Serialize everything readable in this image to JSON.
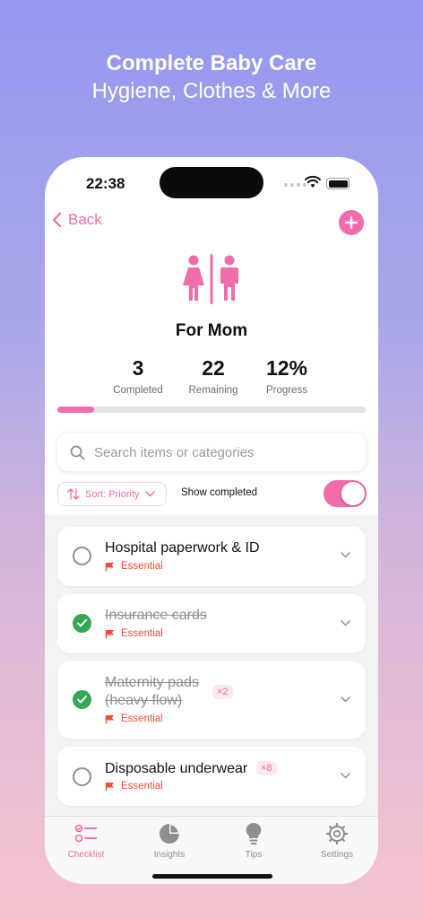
{
  "promo": {
    "headline": "Complete Baby Care",
    "subline": "Hygiene, Clothes & More"
  },
  "status_bar": {
    "time": "22:38"
  },
  "nav": {
    "back_label": "Back",
    "add_icon": "plus-icon"
  },
  "header": {
    "icon": "restroom-icon",
    "title": "For Mom"
  },
  "stats": [
    {
      "value": "3",
      "label": "Completed"
    },
    {
      "value": "22",
      "label": "Remaining"
    },
    {
      "value": "12%",
      "label": "Progress"
    }
  ],
  "progress": {
    "fraction": 0.12,
    "color": "#f06cab"
  },
  "search": {
    "placeholder": "Search items or categories"
  },
  "filters": {
    "sort_label": "Sort: Priority",
    "show_completed_label": "Show completed",
    "show_completed_on": true
  },
  "items": [
    {
      "name": "Hospital paperwork & ID",
      "tag": "Essential",
      "done": false,
      "qty": ""
    },
    {
      "name": "Insurance cards",
      "tag": "Essential",
      "done": true,
      "qty": ""
    },
    {
      "name_line1": "Maternity pads",
      "name_line2": "(heavy flow)",
      "tag": "Essential",
      "done": true,
      "qty": "×2"
    },
    {
      "name": "Disposable underwear",
      "tag": "Essential",
      "done": false,
      "qty": "×8"
    }
  ],
  "tabs": [
    {
      "label": "Checklist",
      "icon": "checklist-icon",
      "active": true
    },
    {
      "label": "Insights",
      "icon": "pie-chart-icon",
      "active": false
    },
    {
      "label": "Tips",
      "icon": "lightbulb-icon",
      "active": false
    },
    {
      "label": "Settings",
      "icon": "gear-icon",
      "active": false
    }
  ],
  "colors": {
    "accent": "#f06cab",
    "essential": "#f04e37",
    "done": "#34a853"
  }
}
